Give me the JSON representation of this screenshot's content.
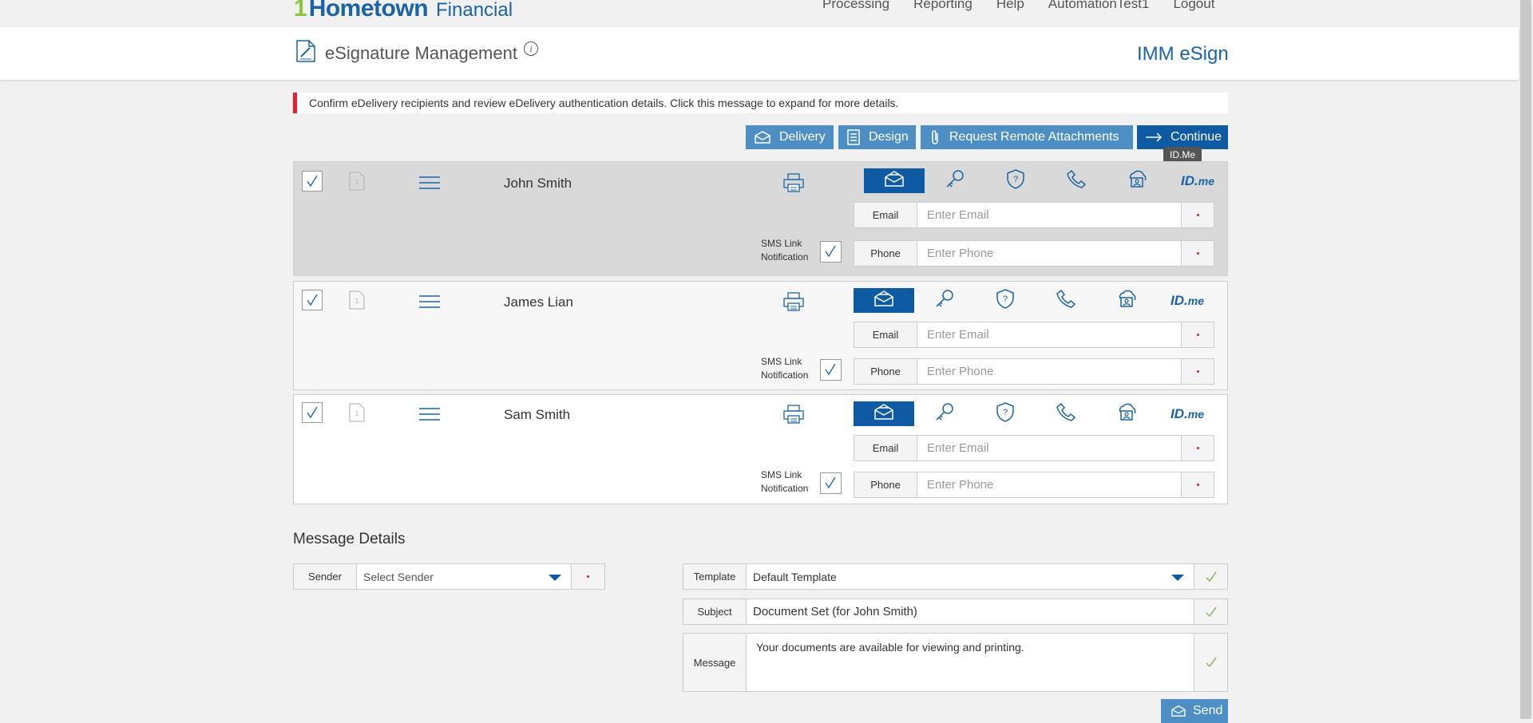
{
  "brand": {
    "logo_main": "Hometown",
    "logo_sub": "Financial"
  },
  "topnav": [
    "Processing",
    "Reporting",
    "Help",
    "AutomationTest1",
    "Logout"
  ],
  "header": {
    "title": "eSignature Management",
    "info": "i",
    "product": "IMM eSign"
  },
  "alert": {
    "text": "Confirm eDelivery recipients and review eDelivery authentication details. Click this message to expand for more details."
  },
  "actions": {
    "delivery": "Delivery",
    "design": "Design",
    "remote": "Request Remote Attachments",
    "continue": "Continue"
  },
  "tooltip": "ID.Me",
  "idme": {
    "id": "ID.",
    "me": "me"
  },
  "recipients": [
    {
      "name": "John Smith",
      "doc_num": "1",
      "email_label": "Email",
      "email_placeholder": "Enter Email",
      "sms_label_1": "SMS Link",
      "sms_label_2": "Notification",
      "phone_label": "Phone",
      "phone_placeholder": "Enter Phone"
    },
    {
      "name": "James Lian",
      "doc_num": "1",
      "email_label": "Email",
      "email_placeholder": "Enter Email",
      "sms_label_1": "SMS Link",
      "sms_label_2": "Notification",
      "phone_label": "Phone",
      "phone_placeholder": "Enter Phone"
    },
    {
      "name": "Sam Smith",
      "doc_num": "1",
      "email_label": "Email",
      "email_placeholder": "Enter Email",
      "sms_label_1": "SMS Link",
      "sms_label_2": "Notification",
      "phone_label": "Phone",
      "phone_placeholder": "Enter Phone"
    }
  ],
  "message": {
    "title": "Message Details",
    "sender_label": "Sender",
    "sender_value": "Select Sender",
    "template_label": "Template",
    "template_value": "Default Template",
    "subject_label": "Subject",
    "subject_value": "Document Set (for John Smith)",
    "message_label": "Message",
    "message_value": "Your documents are available for viewing and printing.",
    "send": "Send"
  },
  "colors": {
    "primary": "#0e5aa3",
    "secondary": "#4d8fc4",
    "alert": "#e8202a",
    "logo_green": "#8cc63f"
  }
}
